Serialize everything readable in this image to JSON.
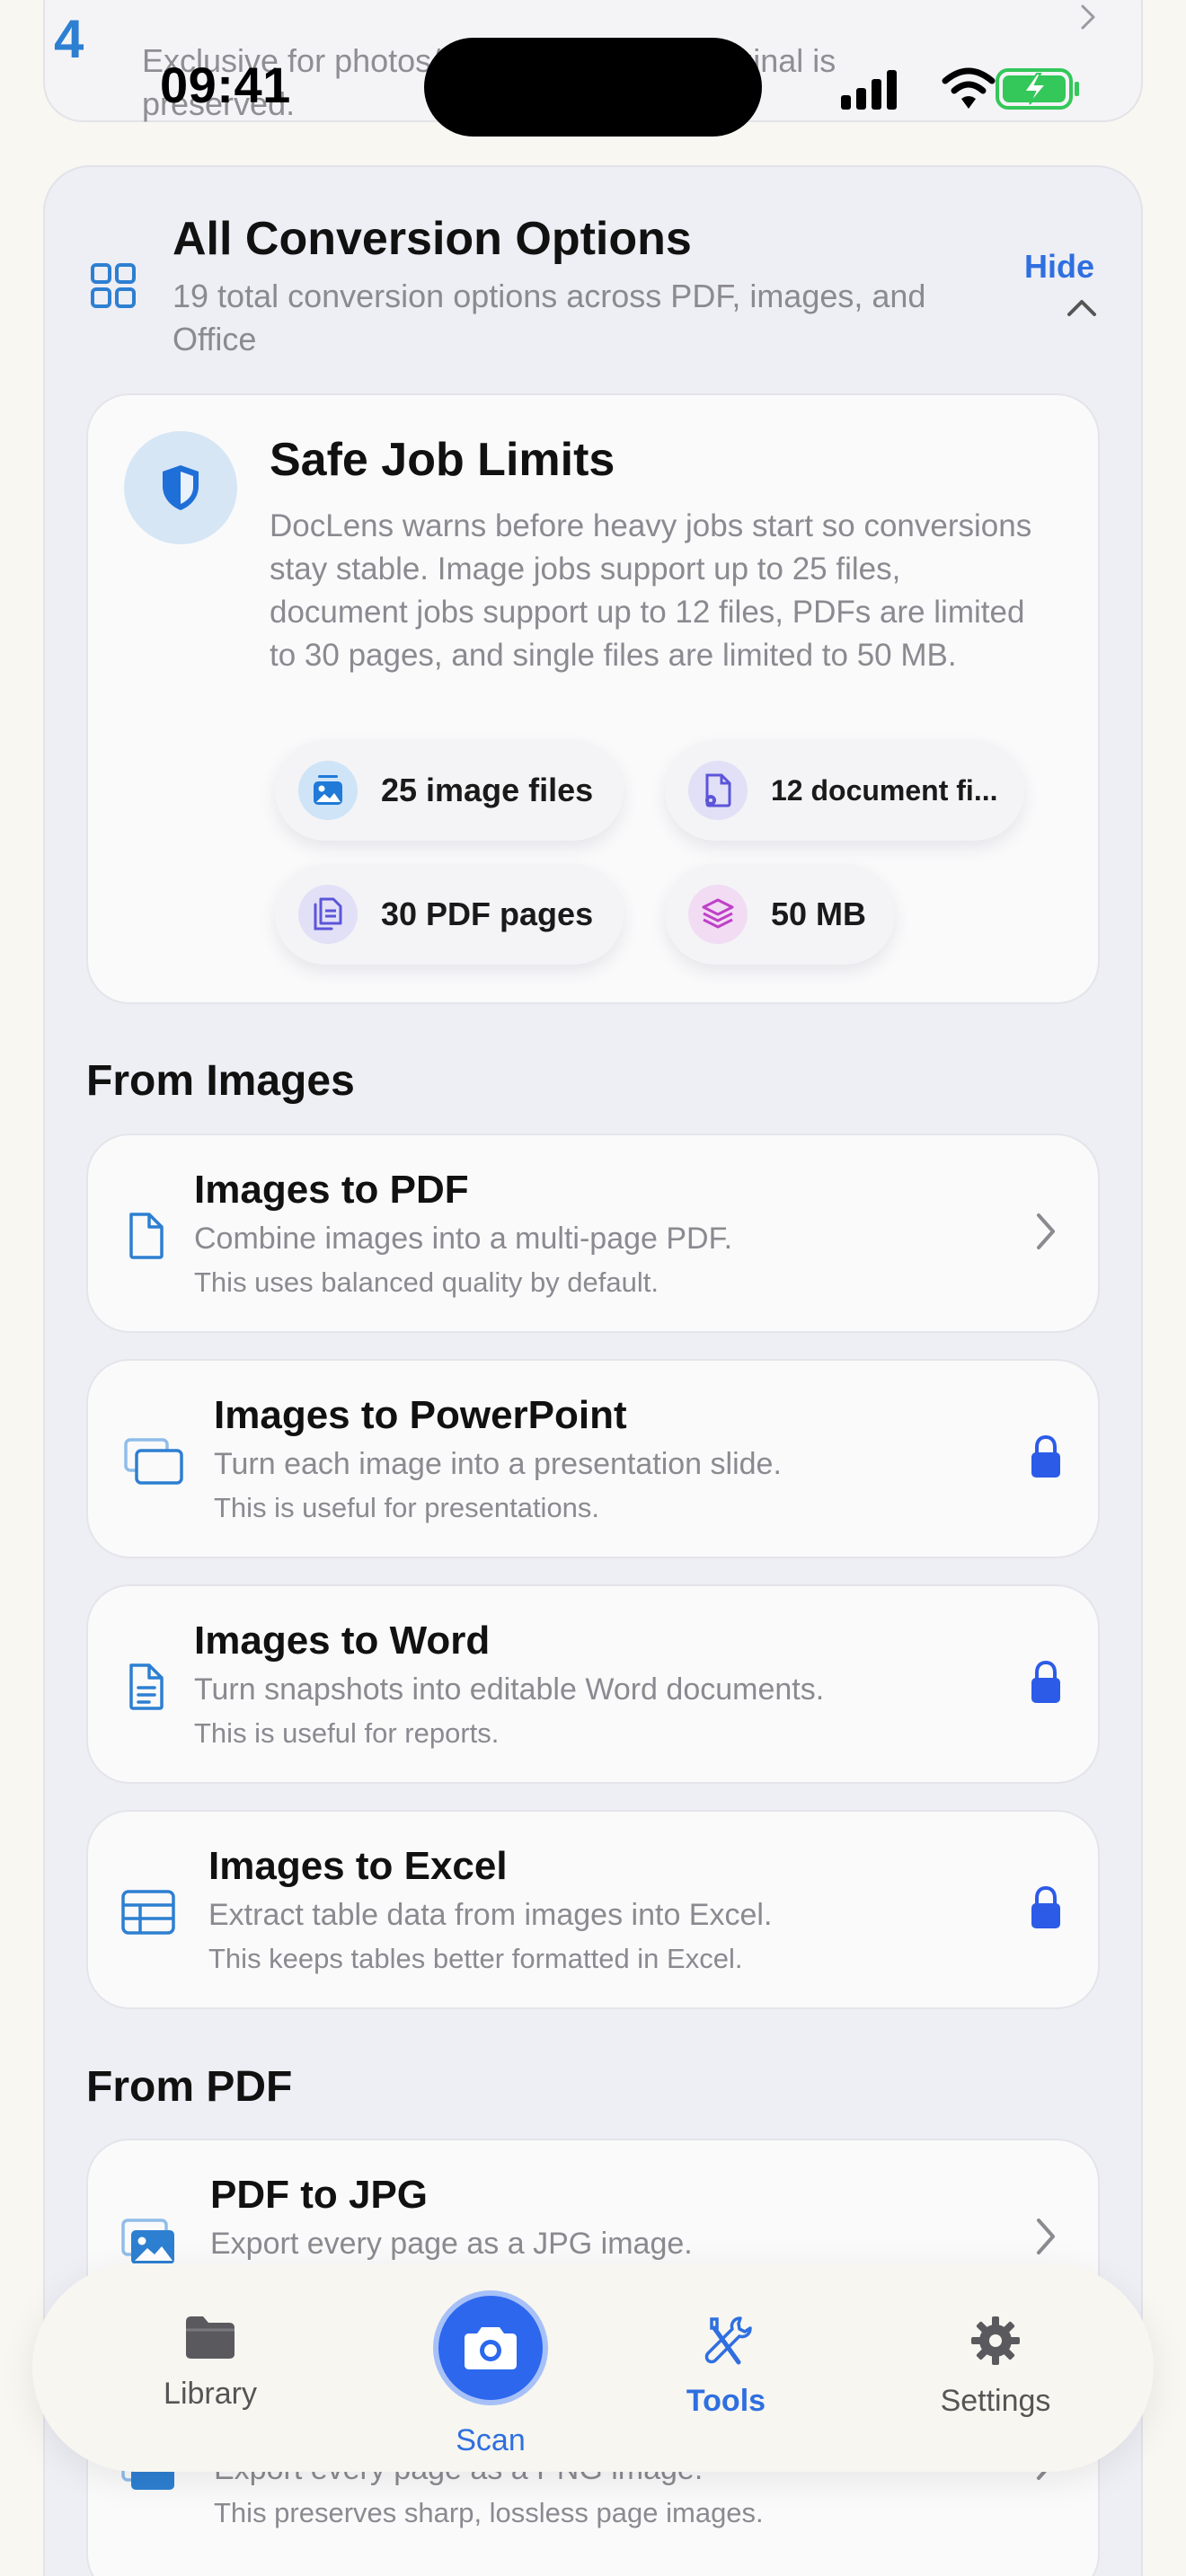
{
  "status_bar": {
    "time": "09:41"
  },
  "top_card": {
    "description": "Exclusive for photos/images/ID cards. Original is preserved."
  },
  "panel": {
    "title": "All Conversion Options",
    "subtitle": "19 total conversion options across PDF, images, and Office",
    "hide_label": "Hide"
  },
  "limits": {
    "title": "Safe Job Limits",
    "description": "DocLens warns before heavy jobs start so conversions stay stable. Image jobs support up to 25 files, document jobs support up to 12 files, PDFs are limited to 30 pages, and single files are limited to 50 MB.",
    "chips": [
      {
        "label": "25 image files",
        "icon": "image-icon"
      },
      {
        "label": "12 document fi...",
        "icon": "document-gear-icon"
      },
      {
        "label": "30 PDF pages",
        "icon": "pages-icon"
      },
      {
        "label": "50 MB",
        "icon": "layers-icon"
      }
    ]
  },
  "sections": {
    "from_images": "From Images",
    "from_pdf": "From PDF"
  },
  "options": [
    {
      "title": "Images to PDF",
      "line1": "Combine images into a multi-page PDF.",
      "line2": "This uses balanced quality by default.",
      "locked": false
    },
    {
      "title": "Images to PowerPoint",
      "line1": "Turn each image into a presentation slide.",
      "line2": "This is useful for presentations.",
      "locked": true
    },
    {
      "title": "Images to Word",
      "line1": "Turn snapshots into editable Word documents.",
      "line2": "This is useful for reports.",
      "locked": true
    },
    {
      "title": "Images to Excel",
      "line1": "Extract table data from images into Excel.",
      "line2": "This keeps tables better formatted in Excel.",
      "locked": true
    },
    {
      "title": "PDF to JPG",
      "line1": "Export every page as a JPG image.",
      "line2": "",
      "locked": false
    },
    {
      "title": "",
      "line1": "Export every page as a PNG image.",
      "line2": "This preserves sharp, lossless page images.",
      "locked": false
    }
  ],
  "tabbar": {
    "library": "Library",
    "scan": "Scan",
    "tools": "Tools",
    "settings": "Settings",
    "active": "Tools"
  },
  "colors": {
    "accent": "#2f6fe0",
    "icon_blue": "#2d7fd1",
    "muted_text": "#8a8a90",
    "background": "#f8f7f2",
    "panel": "#eeeef5"
  }
}
